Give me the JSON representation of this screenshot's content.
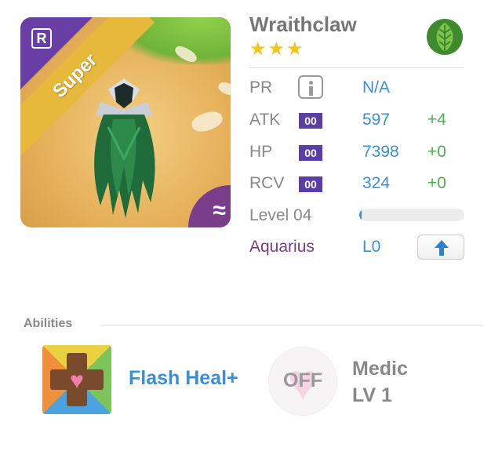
{
  "monster": {
    "name": "Wraithclaw",
    "stars": "★★★",
    "rarity_badge": "R",
    "tier_ribbon": "Super",
    "element_icon": "leaf-icon",
    "affinity_icon": "wave-icon",
    "affinity_glyph": "≈"
  },
  "stats": {
    "pr": {
      "label": "PR",
      "value": "N/A"
    },
    "atk": {
      "label": "ATK",
      "plus": "00",
      "value": "597",
      "bonus": "+4"
    },
    "hp": {
      "label": "HP",
      "plus": "00",
      "value": "7398",
      "bonus": "+0"
    },
    "rcv": {
      "label": "RCV",
      "plus": "00",
      "value": "324",
      "bonus": "+0"
    },
    "level": {
      "label": "Level 04",
      "progress": 0.02
    },
    "sign": {
      "label": "Aquarius",
      "value": "L0"
    }
  },
  "abilities": {
    "heading": "Abilities",
    "primary_name": "Flash Heal+",
    "toggle_label": "OFF",
    "class_name": "Medic",
    "class_level": "LV 1"
  },
  "colors": {
    "accent_blue": "#3b8fd6",
    "bonus_green": "#4caf50",
    "purple": "#7a3d8a",
    "ribbon_gold": "#e7b93a",
    "star_gold": "#f4c51b"
  }
}
